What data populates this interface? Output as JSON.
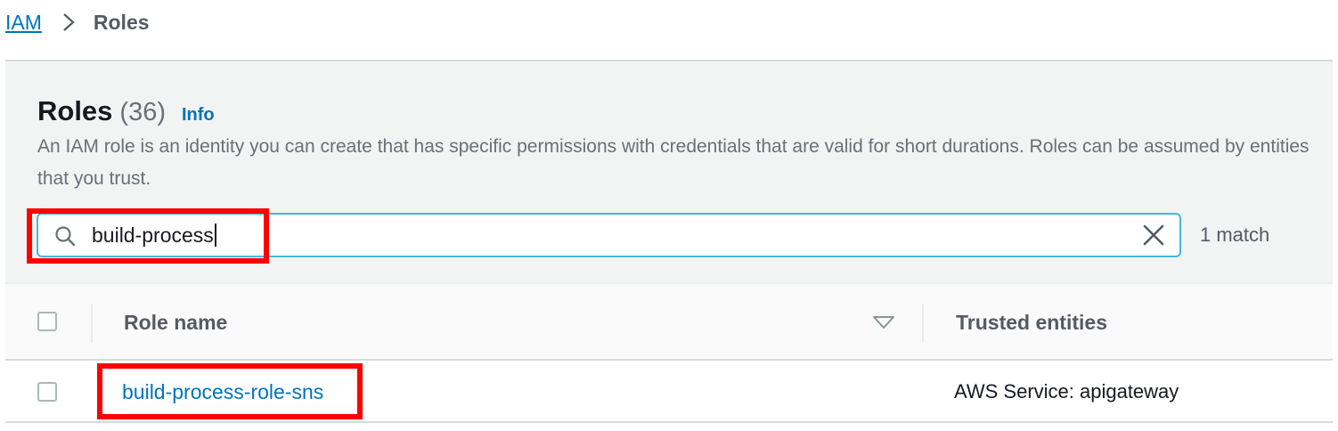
{
  "breadcrumb": {
    "items": [
      {
        "label": "IAM",
        "link": true
      },
      {
        "label": "Roles",
        "link": false
      }
    ]
  },
  "header": {
    "title": "Roles",
    "count": "(36)",
    "info_label": "Info",
    "description": "An IAM role is an identity you can create that has specific permissions with credentials that are valid for short durations. Roles can be assumed by entities that you trust."
  },
  "search": {
    "value": "build-process",
    "match_count": "1 match"
  },
  "table": {
    "columns": [
      "Role name",
      "Trusted entities"
    ],
    "rows": [
      {
        "role_name": "build-process-role-sns",
        "trusted_entities": "AWS Service: apigateway"
      }
    ]
  },
  "highlight_color": "#ff0000",
  "colors": {
    "link": "#0073bb",
    "panel_bg": "#f2f3f3",
    "focus_border": "#44b9d6"
  },
  "icons": [
    "chevron-right-icon",
    "search-icon",
    "clear-icon",
    "sort-down-icon"
  ]
}
